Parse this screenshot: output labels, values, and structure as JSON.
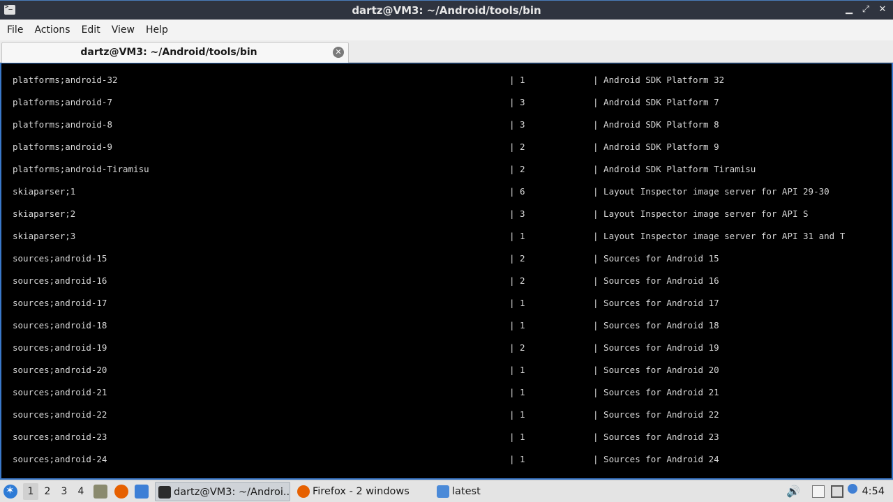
{
  "window": {
    "title": "dartz@VM3: ~/Android/tools/bin"
  },
  "menu": [
    "File",
    "Actions",
    "Edit",
    "View",
    "Help"
  ],
  "tab": {
    "label": "dartz@VM3: ~/Android/tools/bin"
  },
  "terminal": {
    "rows": [
      {
        "pkg": "platforms;android-32",
        "ver": "| 1",
        "desc": "| Android SDK Platform 32"
      },
      {
        "pkg": "platforms;android-7",
        "ver": "| 3",
        "desc": "| Android SDK Platform 7"
      },
      {
        "pkg": "platforms;android-8",
        "ver": "| 3",
        "desc": "| Android SDK Platform 8"
      },
      {
        "pkg": "platforms;android-9",
        "ver": "| 2",
        "desc": "| Android SDK Platform 9"
      },
      {
        "pkg": "platforms;android-Tiramisu",
        "ver": "| 2",
        "desc": "| Android SDK Platform Tiramisu"
      },
      {
        "pkg": "skiaparser;1",
        "ver": "| 6",
        "desc": "| Layout Inspector image server for API 29-30"
      },
      {
        "pkg": "skiaparser;2",
        "ver": "| 3",
        "desc": "| Layout Inspector image server for API S"
      },
      {
        "pkg": "skiaparser;3",
        "ver": "| 1",
        "desc": "| Layout Inspector image server for API 31 and T"
      },
      {
        "pkg": "sources;android-15",
        "ver": "| 2",
        "desc": "| Sources for Android 15"
      },
      {
        "pkg": "sources;android-16",
        "ver": "| 2",
        "desc": "| Sources for Android 16"
      },
      {
        "pkg": "sources;android-17",
        "ver": "| 1",
        "desc": "| Sources for Android 17"
      },
      {
        "pkg": "sources;android-18",
        "ver": "| 1",
        "desc": "| Sources for Android 18"
      },
      {
        "pkg": "sources;android-19",
        "ver": "| 2",
        "desc": "| Sources for Android 19"
      },
      {
        "pkg": "sources;android-20",
        "ver": "| 1",
        "desc": "| Sources for Android 20"
      },
      {
        "pkg": "sources;android-21",
        "ver": "| 1",
        "desc": "| Sources for Android 21"
      },
      {
        "pkg": "sources;android-22",
        "ver": "| 1",
        "desc": "| Sources for Android 22"
      },
      {
        "pkg": "sources;android-23",
        "ver": "| 1",
        "desc": "| Sources for Android 23"
      },
      {
        "pkg": "sources;android-24",
        "ver": "| 1",
        "desc": "| Sources for Android 24"
      }
    ]
  },
  "taskbar": {
    "workspaces": [
      "1",
      "2",
      "3",
      "4"
    ],
    "active_workspace": "1",
    "tasks": [
      {
        "label": "dartz@VM3: ~/Androi...",
        "icon": "terminal-icon"
      },
      {
        "label": "Firefox - 2 windows",
        "icon": "firefox-icon"
      },
      {
        "label": "latest",
        "icon": "folder-icon"
      }
    ],
    "clock": "4:54"
  }
}
